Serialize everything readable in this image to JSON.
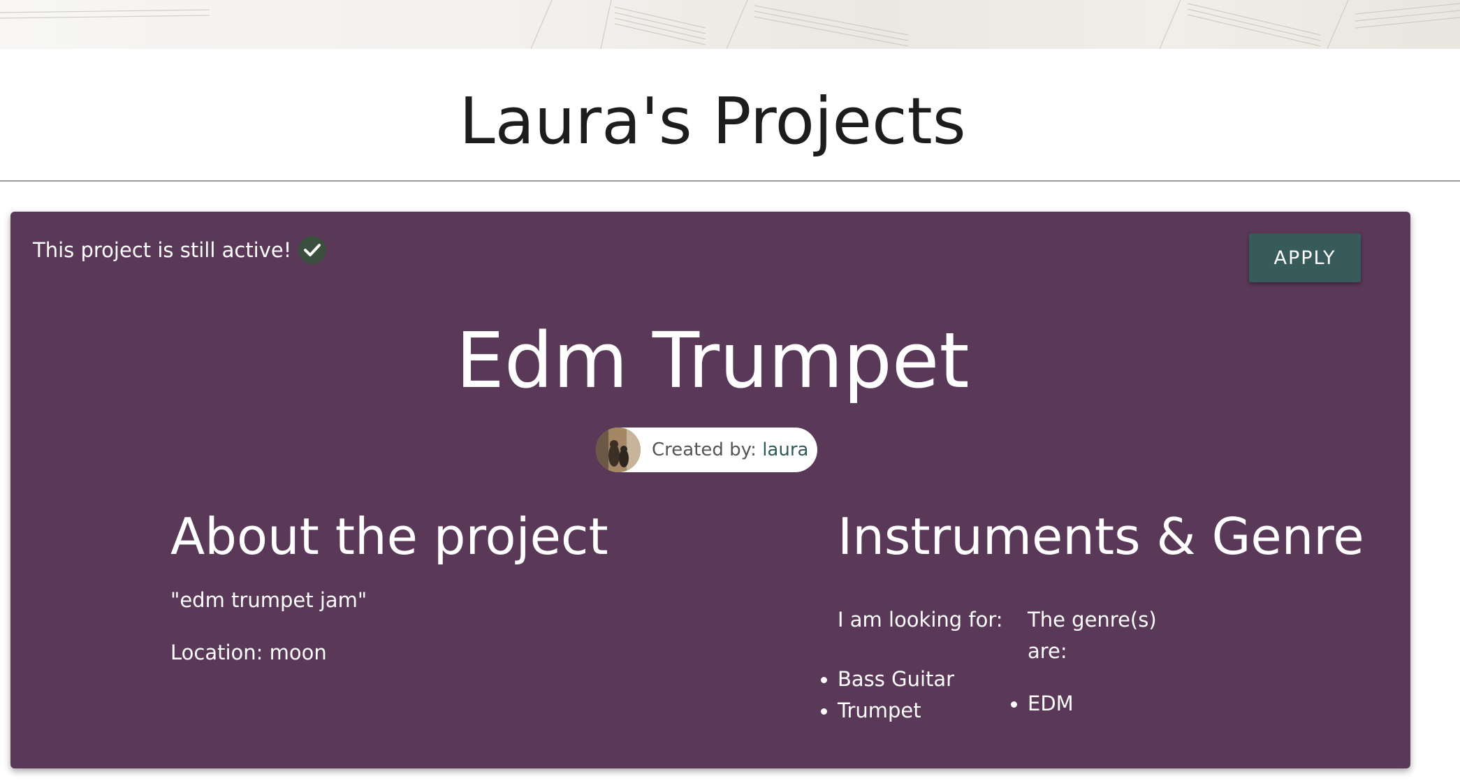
{
  "page": {
    "title": "Laura's Projects"
  },
  "project": {
    "status_text": "This project is still active!",
    "status_icon": "check-icon",
    "apply_label": "APPLY",
    "name": "Edm Trumpet",
    "creator_prefix": "Created by: ",
    "creator_name": "laura",
    "about": {
      "heading": "About the project",
      "description": "\"edm trumpet jam\"",
      "location": "Location: moon"
    },
    "instruments_genre": {
      "heading": "Instruments & Genre",
      "looking_for_label": "I am looking for:",
      "instruments": [
        "Bass Guitar",
        "Trumpet"
      ],
      "genre_label_line1": "The genre(s)",
      "genre_label_line2": "are:",
      "genres": [
        "EDM"
      ]
    }
  },
  "colors": {
    "card_background": "#5a3857",
    "apply_button": "#365b5a",
    "check_badge": "#3b4f3e",
    "creator_name": "#2f5a58"
  }
}
